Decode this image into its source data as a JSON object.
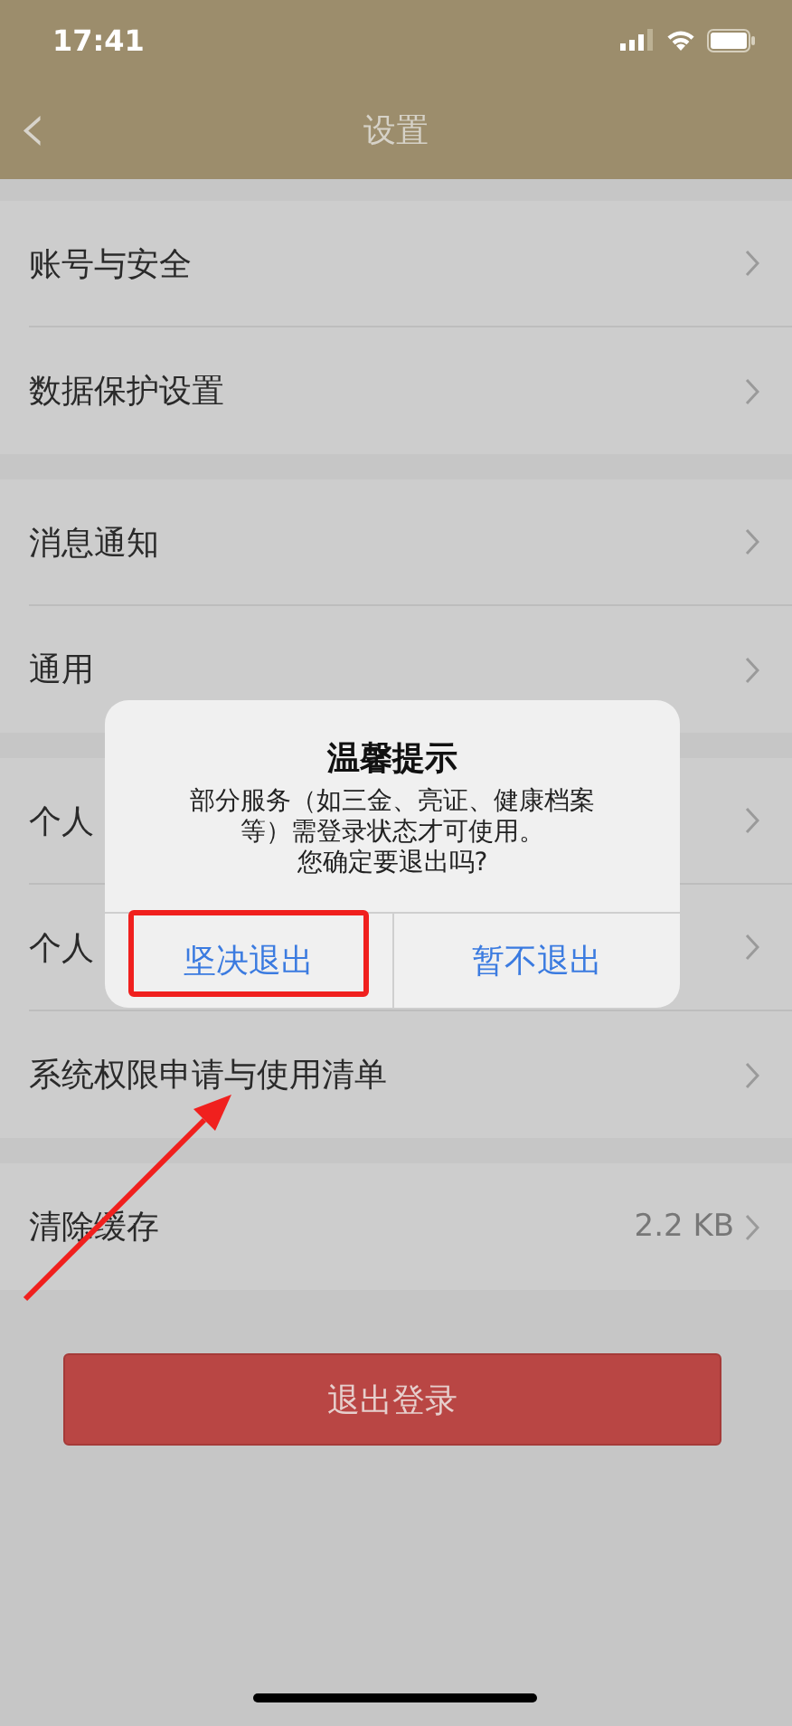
{
  "status_bar": {
    "time": "17:41"
  },
  "nav": {
    "back": "‹",
    "title": "设置"
  },
  "groups": [
    {
      "rows": [
        {
          "label": "账号与安全"
        },
        {
          "label": "数据保护设置"
        }
      ]
    },
    {
      "rows": [
        {
          "label": "消息通知"
        },
        {
          "label": "通用"
        }
      ]
    },
    {
      "rows": [
        {
          "label": "个人"
        },
        {
          "label": "个人"
        },
        {
          "label": "系统权限申请与使用清单"
        }
      ]
    },
    {
      "rows": [
        {
          "label": "清除缓存",
          "value": "2.2 KB"
        }
      ]
    }
  ],
  "logout_button": "退出登录",
  "dialog": {
    "title": "温馨提示",
    "message": "部分服务（如三金、亮证、健康档案等）需登录状态才可使用。",
    "question": "您确定要退出吗?",
    "buttons": [
      {
        "label": "坚决退出",
        "highlighted": true
      },
      {
        "label": "暂不退出",
        "highlighted": false
      }
    ]
  },
  "annotation_arrow": true
}
